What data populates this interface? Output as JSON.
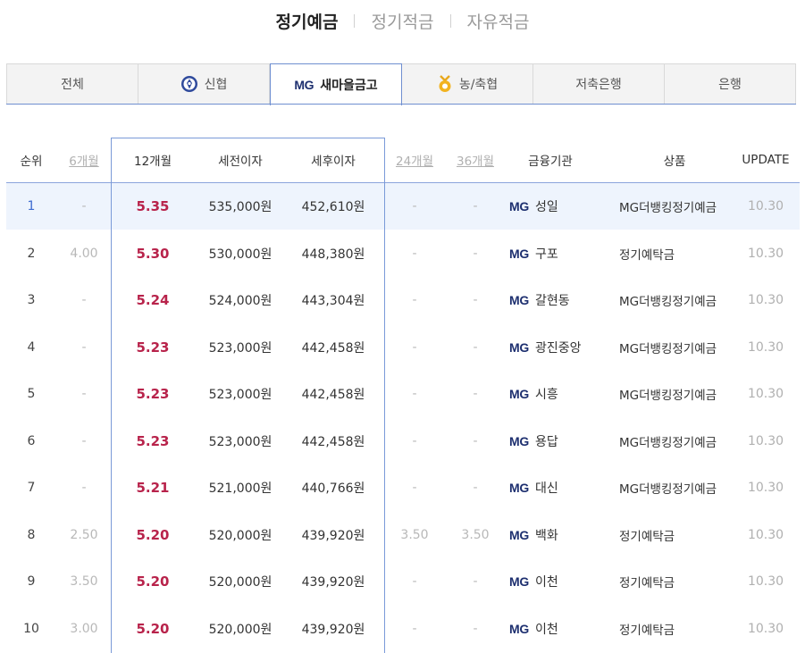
{
  "top_tabs": [
    {
      "label": "정기예금"
    },
    {
      "label": "정기적금"
    },
    {
      "label": "자유적금"
    }
  ],
  "inst_tabs": [
    {
      "label": "전체",
      "icon": ""
    },
    {
      "label": "신협",
      "icon": "shinhyup-logo-icon"
    },
    {
      "label": "새마을금고",
      "icon": "mg-logo",
      "logo_text": "MG"
    },
    {
      "label": "농/축협",
      "icon": "nonghyup-logo-icon"
    },
    {
      "label": "저축은행",
      "icon": ""
    },
    {
      "label": "은행",
      "icon": ""
    }
  ],
  "table": {
    "headers": {
      "rank": "순위",
      "m6": "6개월",
      "m12": "12개월",
      "pre_tax": "세전이자",
      "post_tax": "세후이자",
      "m24": "24개월",
      "m36": "36개월",
      "institution": "금융기관",
      "product": "상품",
      "update": "UPDATE"
    },
    "logo_text": "MG",
    "rows": [
      {
        "rank": "1",
        "m6": "-",
        "m12": "5.35",
        "pre_tax": "535,000원",
        "post_tax": "452,610원",
        "m24": "-",
        "m36": "-",
        "institution": "성일",
        "product": "MG더뱅킹정기예금",
        "update": "10.30"
      },
      {
        "rank": "2",
        "m6": "4.00",
        "m12": "5.30",
        "pre_tax": "530,000원",
        "post_tax": "448,380원",
        "m24": "-",
        "m36": "-",
        "institution": "구포",
        "product": "정기예탁금",
        "update": "10.30"
      },
      {
        "rank": "3",
        "m6": "-",
        "m12": "5.24",
        "pre_tax": "524,000원",
        "post_tax": "443,304원",
        "m24": "-",
        "m36": "-",
        "institution": "갈현동",
        "product": "MG더뱅킹정기예금",
        "update": "10.30"
      },
      {
        "rank": "4",
        "m6": "-",
        "m12": "5.23",
        "pre_tax": "523,000원",
        "post_tax": "442,458원",
        "m24": "-",
        "m36": "-",
        "institution": "광진중앙",
        "product": "MG더뱅킹정기예금",
        "update": "10.30"
      },
      {
        "rank": "5",
        "m6": "-",
        "m12": "5.23",
        "pre_tax": "523,000원",
        "post_tax": "442,458원",
        "m24": "-",
        "m36": "-",
        "institution": "시흥",
        "product": "MG더뱅킹정기예금",
        "update": "10.30"
      },
      {
        "rank": "6",
        "m6": "-",
        "m12": "5.23",
        "pre_tax": "523,000원",
        "post_tax": "442,458원",
        "m24": "-",
        "m36": "-",
        "institution": "용답",
        "product": "MG더뱅킹정기예금",
        "update": "10.30"
      },
      {
        "rank": "7",
        "m6": "-",
        "m12": "5.21",
        "pre_tax": "521,000원",
        "post_tax": "440,766원",
        "m24": "-",
        "m36": "-",
        "institution": "대신",
        "product": "MG더뱅킹정기예금",
        "update": "10.30"
      },
      {
        "rank": "8",
        "m6": "2.50",
        "m12": "5.20",
        "pre_tax": "520,000원",
        "post_tax": "439,920원",
        "m24": "3.50",
        "m36": "3.50",
        "institution": "백화",
        "product": "정기예탁금",
        "update": "10.30"
      },
      {
        "rank": "9",
        "m6": "3.50",
        "m12": "5.20",
        "pre_tax": "520,000원",
        "post_tax": "439,920원",
        "m24": "-",
        "m36": "-",
        "institution": "이천",
        "product": "정기예탁금",
        "update": "10.30"
      },
      {
        "rank": "10",
        "m6": "3.00",
        "m12": "5.20",
        "pre_tax": "520,000원",
        "post_tax": "439,920원",
        "m24": "-",
        "m36": "-",
        "institution": "이천",
        "product": "정기예탁금",
        "update": "10.30"
      }
    ]
  },
  "colors": {
    "accent_blue": "#6f8fd0",
    "rate_red": "#b8234b",
    "mg_navy": "#1d2f6f",
    "first_row_bg": "#eef4fd"
  }
}
